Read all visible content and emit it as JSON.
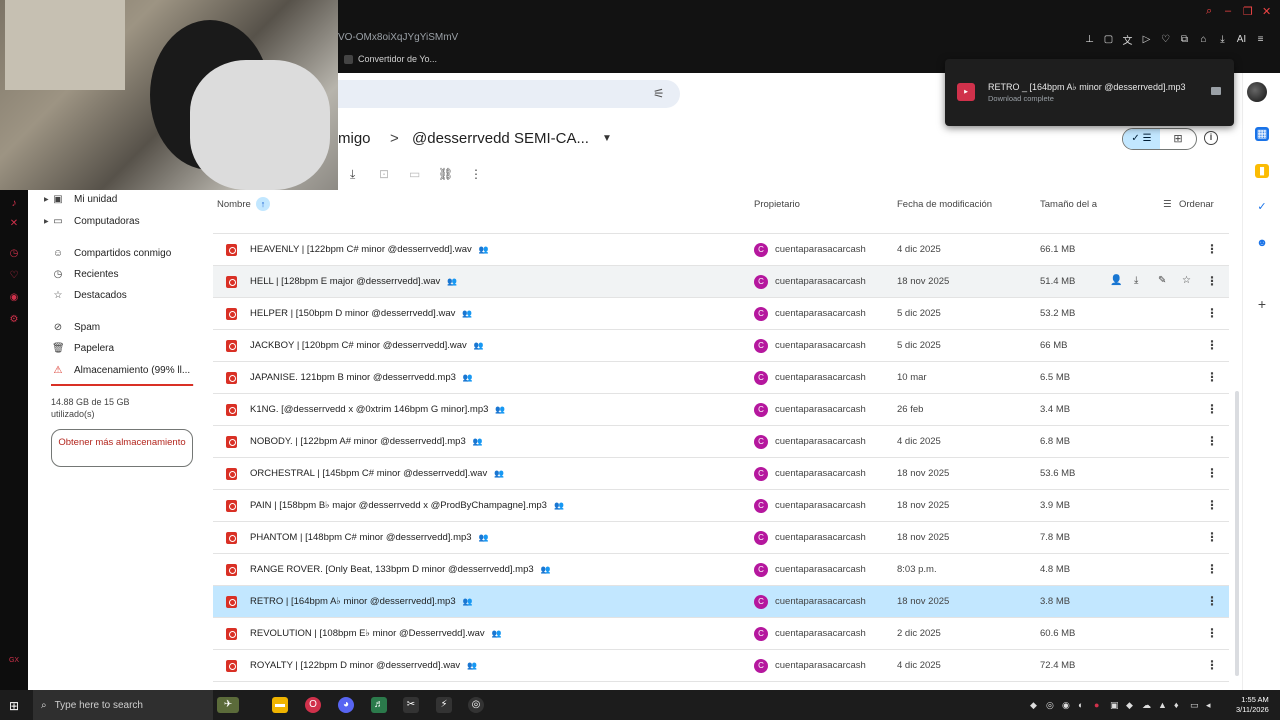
{
  "browser": {
    "url_fragment": "VO-OMx8oiXqJYgYiSMmV",
    "bookmark_label": "Convertidor de Yo..."
  },
  "breadcrumb": {
    "previous": "migo",
    "separator": ">",
    "current": "@desserrvedd SEMI-CA..."
  },
  "nav": {
    "items": [
      {
        "label": "Mi unidad",
        "icon": "drive-icon"
      },
      {
        "label": "Computadoras",
        "icon": "computer-icon"
      },
      {
        "label": "Compartidos conmigo",
        "icon": "shared-icon"
      },
      {
        "label": "Recientes",
        "icon": "clock-icon"
      },
      {
        "label": "Destacados",
        "icon": "star-icon"
      },
      {
        "label": "Spam",
        "icon": "spam-icon"
      },
      {
        "label": "Papelera",
        "icon": "trash-icon"
      },
      {
        "label": "Almacenamiento (99% ll...",
        "icon": "warning-icon"
      }
    ],
    "storage_text": "14.88 GB de 15 GB utilizado(s)",
    "storage_used_fraction": 0.99,
    "get_storage_label": "Obtener más almacenamiento"
  },
  "list": {
    "headers": {
      "name": "Nombre",
      "owner": "Propietario",
      "modified": "Fecha de modificación",
      "size": "Tamaño del a",
      "sort": "Ordenar"
    },
    "rows": [
      {
        "name": "HEAVENLY | [122bpm C# minor @desserrvedd].wav",
        "owner": "cuentaparasacarcash",
        "date": "4 dic 2025",
        "size": "66.1 MB",
        "state": "normal"
      },
      {
        "name": "HELL | [128bpm E major @desserrvedd].wav",
        "owner": "cuentaparasacarcash",
        "date": "18 nov 2025",
        "size": "51.4 MB",
        "state": "hover"
      },
      {
        "name": "HELPER | [150bpm D minor @desserrvedd].wav",
        "owner": "cuentaparasacarcash",
        "date": "5 dic 2025",
        "size": "53.2 MB",
        "state": "normal"
      },
      {
        "name": "JACKBOY | [120bpm C# minor @desserrvedd].wav",
        "owner": "cuentaparasacarcash",
        "date": "5 dic 2025",
        "size": "66 MB",
        "state": "normal"
      },
      {
        "name": "JAPANISE. 121bpm B minor @desserrvedd.mp3",
        "owner": "cuentaparasacarcash",
        "date": "10 mar",
        "size": "6.5 MB",
        "state": "normal"
      },
      {
        "name": "K1NG.  [@desserrvedd x @0xtrim 146bpm G minor].mp3",
        "owner": "cuentaparasacarcash",
        "date": "26 feb",
        "size": "3.4 MB",
        "state": "normal"
      },
      {
        "name": "NOBODY. | [122bpm A# minor @desserrvedd].mp3",
        "owner": "cuentaparasacarcash",
        "date": "4 dic 2025",
        "size": "6.8 MB",
        "state": "normal"
      },
      {
        "name": "ORCHESTRAL | [145bpm C# minor @desserrvedd].wav",
        "owner": "cuentaparasacarcash",
        "date": "18 nov 2025",
        "size": "53.6 MB",
        "state": "normal"
      },
      {
        "name": "PAIN | [158bpm B♭ major @desserrvedd x @ProdByChampagne].mp3",
        "owner": "cuentaparasacarcash",
        "date": "18 nov 2025",
        "size": "3.9 MB",
        "state": "normal"
      },
      {
        "name": "PHANTOM | [148bpm C# minor @desserrvedd].mp3",
        "owner": "cuentaparasacarcash",
        "date": "18 nov 2025",
        "size": "7.8 MB",
        "state": "normal"
      },
      {
        "name": "RANGE ROVER. [Only Beat, 133bpm D minor @desserrvedd].mp3",
        "owner": "cuentaparasacarcash",
        "date": "8:03 p.m.",
        "size": "4.8 MB",
        "state": "normal"
      },
      {
        "name": "RETRO | [164bpm A♭ minor @desserrvedd].mp3",
        "owner": "cuentaparasacarcash",
        "date": "18 nov 2025",
        "size": "3.8 MB",
        "state": "selected"
      },
      {
        "name": "REVOLUTION | [108bpm E♭ minor @Desserrvedd].wav",
        "owner": "cuentaparasacarcash",
        "date": "2 dic 2025",
        "size": "60.6 MB",
        "state": "normal"
      },
      {
        "name": "ROYALTY | [122bpm D minor @desserrvedd].wav",
        "owner": "cuentaparasacarcash",
        "date": "4 dic 2025",
        "size": "72.4 MB",
        "state": "normal"
      }
    ],
    "avatar_letter": "C",
    "avatar_color": "#b5179e"
  },
  "download": {
    "title": "RETRO _ [164bpm A♭ minor @desserrvedd].mp3",
    "status": "Download complete"
  },
  "taskbar": {
    "search_placeholder": "Type here to search",
    "time": "1:55 AM",
    "date": "3/11/2026"
  },
  "colors": {
    "accent": "#c2e7ff",
    "file_icon": "#d93025",
    "opera_red": "#d0314b"
  }
}
